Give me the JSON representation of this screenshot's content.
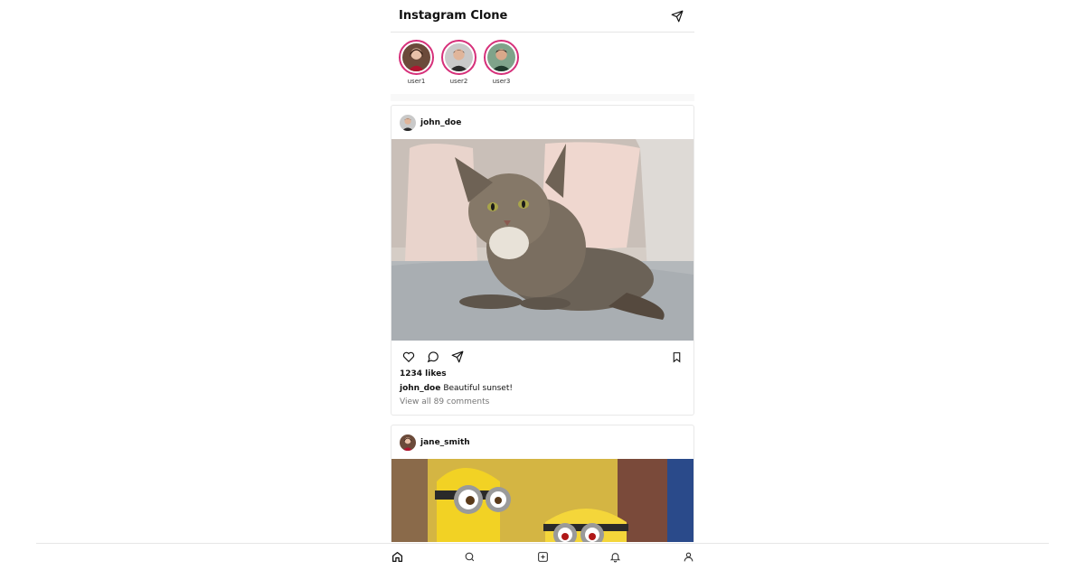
{
  "header": {
    "title": "Instagram Clone"
  },
  "stories": [
    {
      "username": "user1"
    },
    {
      "username": "user2"
    },
    {
      "username": "user3"
    }
  ],
  "posts": [
    {
      "username": "john_doe",
      "likes": "1234 likes",
      "caption_user": "john_doe",
      "caption": "Beautiful sunset!",
      "comments_link": "View all 89 comments"
    },
    {
      "username": "jane_smith"
    }
  ],
  "nav": [
    "home-icon",
    "search-icon",
    "add-post-icon",
    "notifications-icon",
    "profile-icon"
  ],
  "colors": {
    "story_ring": "#d6307a",
    "border": "#e6e6e6"
  }
}
